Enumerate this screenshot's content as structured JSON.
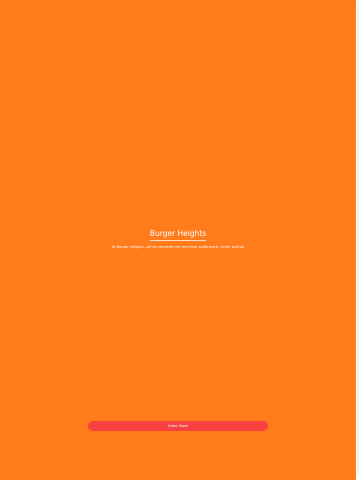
{
  "app": {
    "title": "Burger Heights",
    "tagline": "At Burger Heights, we've elevated the fast food experience. Order online!",
    "order_button_label": "Order Now!"
  },
  "colors": {
    "background": "#ff7b1b",
    "button": "#f6413e",
    "text": "#ffffff"
  }
}
